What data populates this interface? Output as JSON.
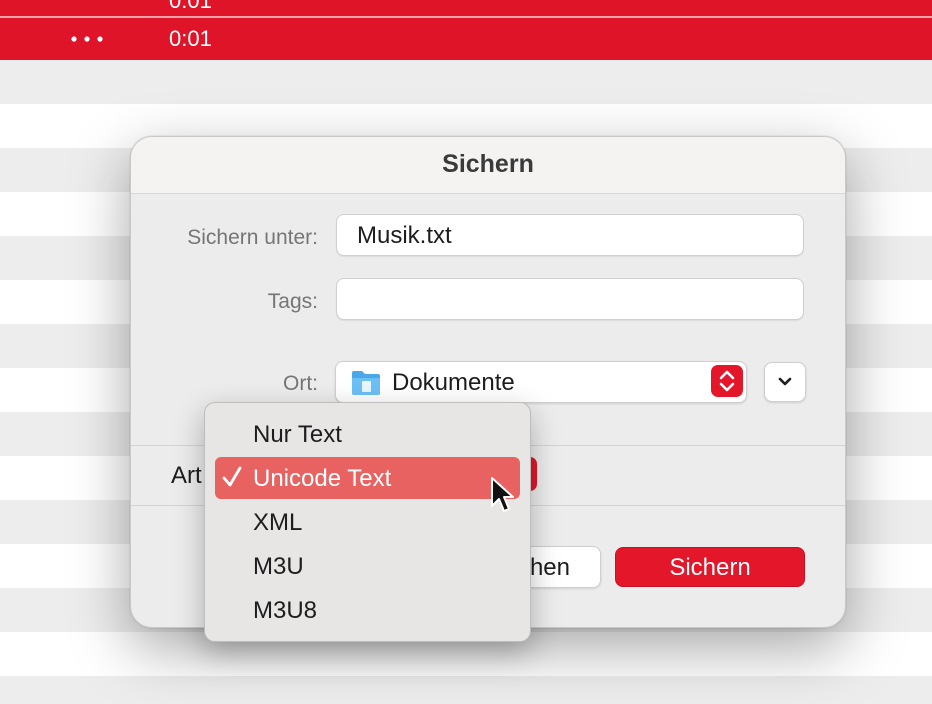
{
  "list": {
    "top_row_time": "0:01",
    "selected_row": {
      "more_icon": "…",
      "time": "0:01"
    }
  },
  "dialog": {
    "title": "Sichern",
    "save_as": {
      "label": "Sichern unter:",
      "value": "Musik.txt"
    },
    "tags": {
      "label": "Tags:",
      "value": ""
    },
    "location": {
      "label": "Ort:",
      "value": "Dokumente",
      "icon": "folder-icon"
    },
    "format_label": "Art",
    "cancel_label_visible": "hen",
    "save_button": "Sichern"
  },
  "format_menu": {
    "items": [
      {
        "label": "Nur Text",
        "selected": false
      },
      {
        "label": "Unicode Text",
        "selected": true
      },
      {
        "label": "XML",
        "selected": false
      },
      {
        "label": "M3U",
        "selected": false
      },
      {
        "label": "M3U8",
        "selected": false
      }
    ]
  },
  "colors": {
    "accent": "#e3162a",
    "menu_highlight": "#e96262"
  }
}
